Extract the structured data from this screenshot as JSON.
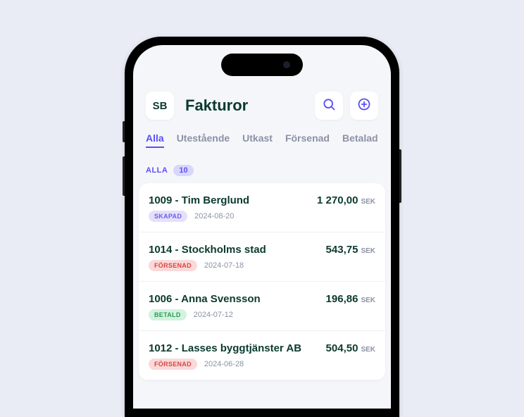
{
  "header": {
    "avatar_initials": "SB",
    "title": "Fakturor"
  },
  "tabs": [
    {
      "label": "Alla",
      "active": true
    },
    {
      "label": "Utestående",
      "active": false
    },
    {
      "label": "Utkast",
      "active": false
    },
    {
      "label": "Försenad",
      "active": false
    },
    {
      "label": "Betalad",
      "active": false
    }
  ],
  "section": {
    "label": "ALLA",
    "count": "10"
  },
  "currency": "SEK",
  "invoices": [
    {
      "title": "1009 - Tim Berglund",
      "amount": "1 270,00",
      "status_label": "SKAPAD",
      "status_class": "status-skapad",
      "date": "2024-08-20"
    },
    {
      "title": "1014 - Stockholms stad",
      "amount": "543,75",
      "status_label": "FÖRSENAD",
      "status_class": "status-forsenad",
      "date": "2024-07-18"
    },
    {
      "title": "1006 - Anna Svensson",
      "amount": "196,86",
      "status_label": "BETALD",
      "status_class": "status-betald",
      "date": "2024-07-12"
    },
    {
      "title": "1012 - Lasses byggtjänster AB",
      "amount": "504,50",
      "status_label": "FÖRSENAD",
      "status_class": "status-forsenad",
      "date": "2024-06-28"
    }
  ],
  "colors": {
    "accent": "#5b4ff5",
    "primary_text": "#0b3a2e"
  }
}
